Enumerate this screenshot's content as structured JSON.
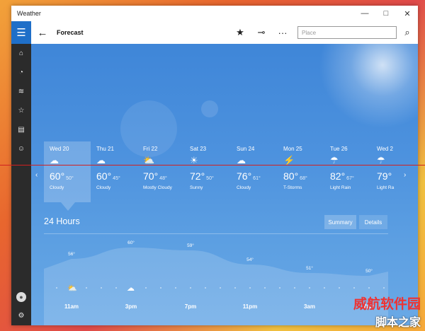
{
  "window": {
    "title": "Weather"
  },
  "window_controls": [
    "—",
    "□",
    "✕"
  ],
  "appbar": {
    "back_icon": "back-arrow-icon",
    "title": "Forecast",
    "favorite_icon": "star-icon",
    "pin_icon": "pin-icon",
    "more_label": "···",
    "search_placeholder": "Place",
    "search_icon": "search-icon"
  },
  "sidebar": {
    "items": [
      {
        "icon": "home-icon",
        "glyph": "⌂"
      },
      {
        "icon": "maps-icon",
        "glyph": "◔"
      },
      {
        "icon": "historical-weather-icon",
        "glyph": "≋"
      },
      {
        "icon": "places-icon",
        "glyph": "☆"
      },
      {
        "icon": "news-icon",
        "glyph": "▤"
      },
      {
        "icon": "feedback-icon",
        "glyph": "☺"
      }
    ],
    "bottom": [
      {
        "icon": "account-icon",
        "glyph": "●"
      },
      {
        "icon": "settings-icon",
        "glyph": "⚙"
      }
    ]
  },
  "forecast": {
    "days": [
      {
        "name": "Wed 20",
        "icon": "cloudy-icon",
        "glyph": "☁",
        "high": "60°",
        "low": "50°",
        "condition": "Cloudy"
      },
      {
        "name": "Thu 21",
        "icon": "cloudy-icon",
        "glyph": "☁",
        "high": "60°",
        "low": "45°",
        "condition": "Cloudy"
      },
      {
        "name": "Fri 22",
        "icon": "mostly-cloudy-icon",
        "glyph": "⛅",
        "high": "70°",
        "low": "48°",
        "condition": "Mostly Cloudy"
      },
      {
        "name": "Sat 23",
        "icon": "sunny-icon",
        "glyph": "☀",
        "high": "72°",
        "low": "50°",
        "condition": "Sunny"
      },
      {
        "name": "Sun 24",
        "icon": "cloudy-icon",
        "glyph": "☁",
        "high": "76°",
        "low": "61°",
        "condition": "Cloudy"
      },
      {
        "name": "Mon 25",
        "icon": "thunderstorm-icon",
        "glyph": "⚡",
        "high": "80°",
        "low": "68°",
        "condition": "T-Storms"
      },
      {
        "name": "Tue 26",
        "icon": "light-rain-icon",
        "glyph": "☂",
        "high": "82°",
        "low": "67°",
        "condition": "Light Rain"
      },
      {
        "name": "Wed 2",
        "icon": "light-rain-icon",
        "glyph": "☂",
        "high": "79°",
        "low": "",
        "condition": "Light Ra"
      }
    ],
    "prev_arrow": "‹",
    "next_arrow": "›"
  },
  "hourly": {
    "title": "24 Hours",
    "tabs": {
      "summary": "Summary",
      "details": "Details"
    },
    "temps": [
      {
        "label": "56°",
        "value": 56
      },
      {
        "label": "60°",
        "value": 60
      },
      {
        "label": "59°",
        "value": 59
      },
      {
        "label": "54°",
        "value": 54
      },
      {
        "label": "51°",
        "value": 51
      },
      {
        "label": "50°",
        "value": 50
      }
    ],
    "times": [
      "11am",
      "3pm",
      "7pm",
      "11pm",
      "3am",
      "7am"
    ],
    "icons": [
      {
        "icon": "partly-cloudy-icon",
        "glyph": "⛅"
      },
      {
        "icon": "cloudy-icon",
        "glyph": "☁"
      }
    ]
  },
  "watermark": {
    "line1": "威航软件园",
    "line2": "脚本之家"
  }
}
